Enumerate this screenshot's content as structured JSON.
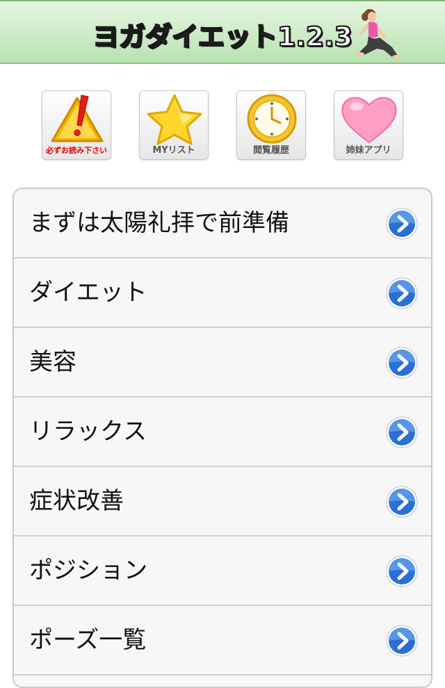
{
  "header": {
    "title": "ヨガダイエット1.2.3"
  },
  "shortcuts": [
    {
      "label": "必ずお読み下さい",
      "icon": "warning-icon"
    },
    {
      "label": "MYリスト",
      "icon": "star-icon"
    },
    {
      "label": "閲覧履歴",
      "icon": "clock-icon"
    },
    {
      "label": "姉妹アプリ",
      "icon": "heart-icon"
    }
  ],
  "menu": {
    "items": [
      {
        "label": "まずは太陽礼拝で前準備"
      },
      {
        "label": "ダイエット"
      },
      {
        "label": "美容"
      },
      {
        "label": "リラックス"
      },
      {
        "label": "症状改善"
      },
      {
        "label": "ポジション"
      },
      {
        "label": "ポーズ一覧"
      }
    ]
  },
  "colors": {
    "header_green": "#b8e2b0",
    "arrow_blue": "#2a6fd6",
    "warning_red": "#e40000"
  }
}
